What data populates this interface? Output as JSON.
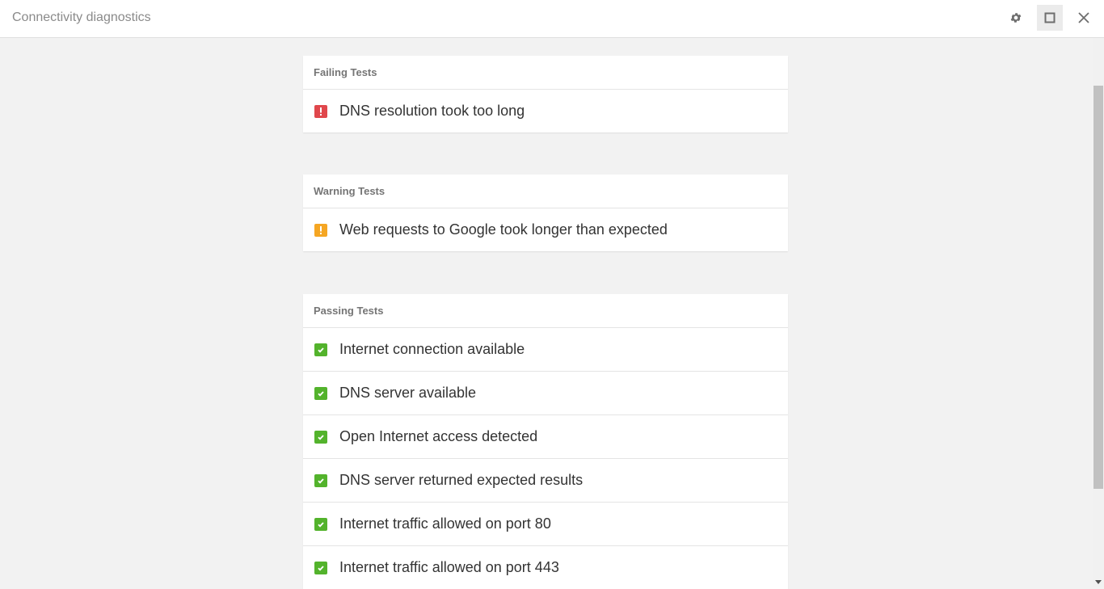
{
  "window": {
    "title": "Connectivity diagnostics",
    "controls": {
      "settings": "gear-icon",
      "maximize": "maximize-icon",
      "close": "close-icon"
    }
  },
  "sections": [
    {
      "header": "Failing Tests",
      "status": "fail",
      "items": [
        "DNS resolution took too long"
      ]
    },
    {
      "header": "Warning Tests",
      "status": "warn",
      "items": [
        "Web requests to Google took longer than expected"
      ]
    },
    {
      "header": "Passing Tests",
      "status": "pass",
      "items": [
        "Internet connection available",
        "DNS server available",
        "Open Internet access detected",
        "DNS server returned expected results",
        "Internet traffic allowed on port 80",
        "Internet traffic allowed on port 443"
      ]
    }
  ],
  "colors": {
    "fail": "#e0474c",
    "warn": "#f5a623",
    "pass": "#53b32c"
  }
}
